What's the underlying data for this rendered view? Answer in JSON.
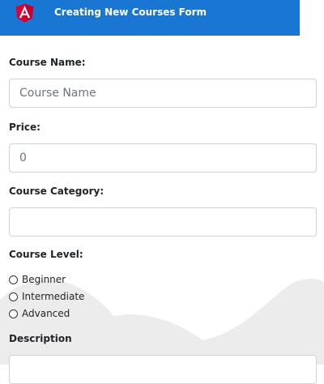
{
  "header": {
    "title": "Creating New Courses Form",
    "logo_icon": "angular-logo-icon",
    "color": "#1976d2"
  },
  "form": {
    "course_name": {
      "label": "Course Name:",
      "placeholder": "Course Name",
      "value": ""
    },
    "price": {
      "label": "Price:",
      "value": "0"
    },
    "category": {
      "label": "Course Category:",
      "value": ""
    },
    "level": {
      "label": "Course Level:",
      "options": [
        "Beginner",
        "Intermediate",
        "Advanced"
      ]
    },
    "description": {
      "label": "Description",
      "value": ""
    }
  }
}
